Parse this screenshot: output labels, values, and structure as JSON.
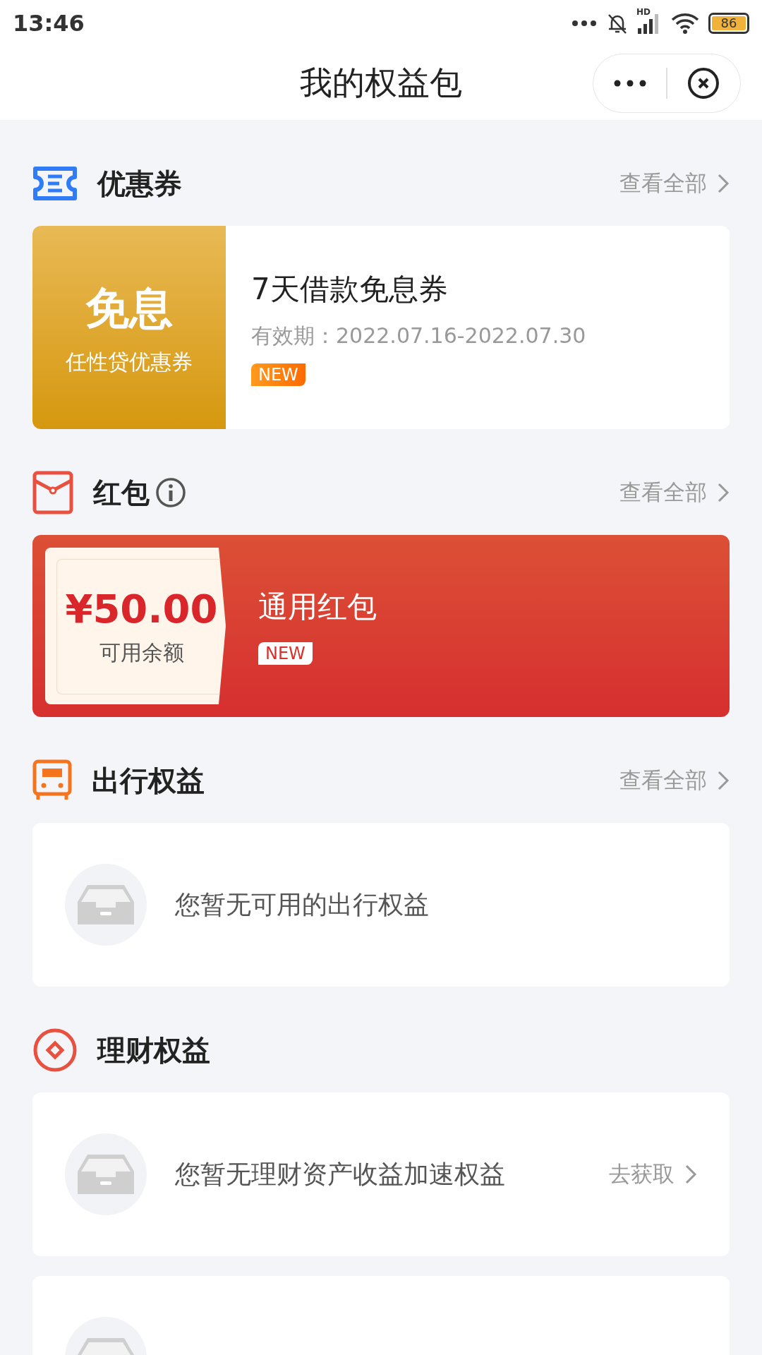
{
  "status_bar": {
    "time": "13:46",
    "network": "HD",
    "battery": "86"
  },
  "nav": {
    "title": "我的权益包"
  },
  "sections": [
    {
      "kind": "coupon",
      "title": "优惠券",
      "more": "查看全部",
      "cards": [
        {
          "kind": "coupon",
          "badge_title": "免息",
          "badge_sub": "任性贷优惠券",
          "name": "7天借款免息券",
          "validity": "有效期：2022.07.16-2022.07.30",
          "tag": "NEW"
        }
      ]
    },
    {
      "kind": "redpacket",
      "title": "红包",
      "more": "查看全部",
      "cards": [
        {
          "kind": "redpacket",
          "amount": "¥50.00",
          "amount_label": "可用余额",
          "name": "通用红包",
          "tag": "NEW"
        }
      ]
    },
    {
      "kind": "travel",
      "title": "出行权益",
      "more": "查看全部",
      "cards": [
        {
          "kind": "empty",
          "message": "您暂无可用的出行权益"
        }
      ]
    },
    {
      "kind": "finance",
      "title": "理财权益",
      "cards": [
        {
          "kind": "empty",
          "message": "您暂无理财资产收益加速权益",
          "action": "去获取"
        },
        {
          "kind": "empty"
        }
      ]
    }
  ]
}
